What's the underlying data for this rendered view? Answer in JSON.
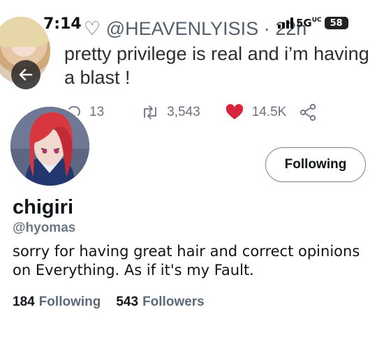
{
  "status_bar": {
    "time": "7:14",
    "network": "5G",
    "network_sub": "UC",
    "battery": "58"
  },
  "tweet": {
    "author_handle": "@HEAVENLYISIS",
    "separator": "·",
    "age": "22h",
    "text": "pretty privilege is real and i’m having\na blast !",
    "reply_count": "13",
    "retweet_count": "3,543",
    "like_count": "14.5K",
    "like_color": "#d7263d"
  },
  "profile": {
    "follow_button_label": "Following",
    "display_name": "chigiri",
    "username": "@hyomas",
    "bio": "sorry for having great hair and correct opinions on Everything. As if it's my Fault.",
    "following_count": "184",
    "following_label": "Following",
    "followers_count": "543",
    "followers_label": "Followers"
  },
  "icons": {
    "back": "arrow-left-icon",
    "reply": "speech-bubble-icon",
    "retweet": "retweet-icon",
    "like": "heart-icon",
    "share": "share-icon"
  }
}
